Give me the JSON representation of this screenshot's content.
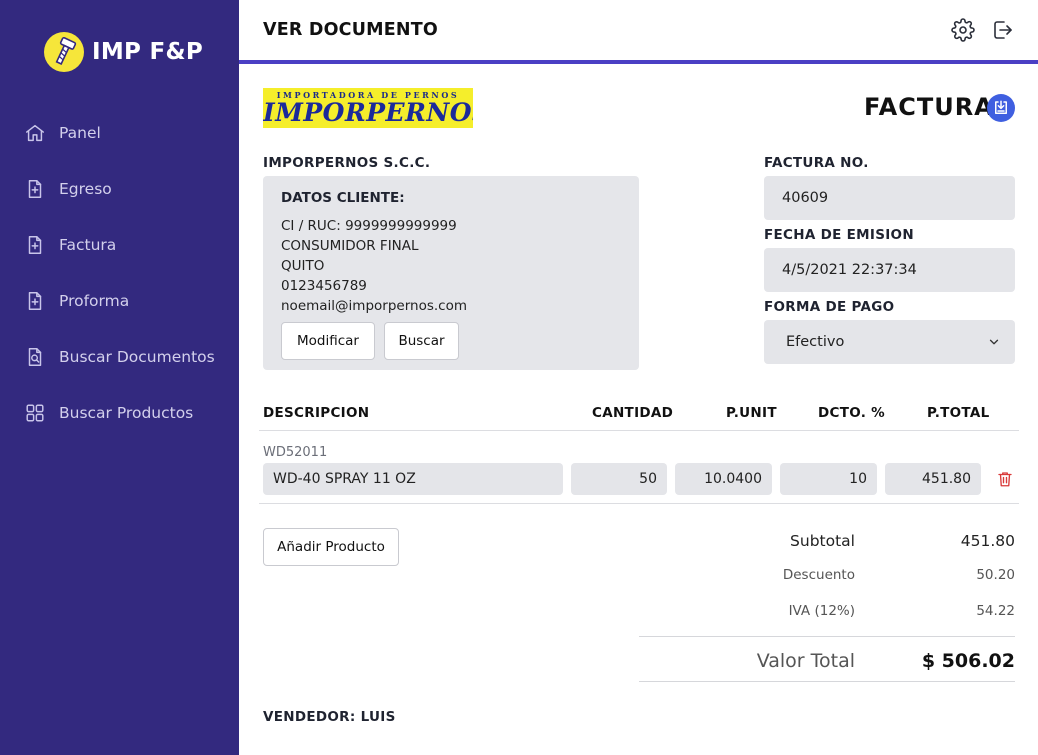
{
  "brand": {
    "name": "IMP F&P",
    "logo_icon": "bolt-icon",
    "logo_color": "#f6e63a"
  },
  "sidebar": {
    "background": "#33297f",
    "items": [
      {
        "label": "Panel",
        "icon": "home-icon"
      },
      {
        "label": "Egreso",
        "icon": "document-plus-icon"
      },
      {
        "label": "Factura",
        "icon": "document-plus-icon"
      },
      {
        "label": "Proforma",
        "icon": "document-plus-icon"
      },
      {
        "label": "Buscar Documentos",
        "icon": "document-search-icon"
      },
      {
        "label": "Buscar Productos",
        "icon": "grid-icon"
      }
    ]
  },
  "header": {
    "title": "VER DOCUMENTO",
    "accent": "#4b3fc4",
    "icons": [
      "gear-icon",
      "logout-icon"
    ]
  },
  "document": {
    "logo_small": "IMPORTADORA DE PERNOS",
    "logo_big": "IMPORPERNOS",
    "title": "FACTURA",
    "company": "IMPORPERNOS S.C.C."
  },
  "client": {
    "title": "DATOS CLIENTE:",
    "ci_ruc": "CI / RUC: 9999999999999",
    "name": "CONSUMIDOR FINAL",
    "city": "QUITO",
    "phone": "0123456789",
    "email": "noemail@imporpernos.com",
    "modify_label": "Modificar",
    "search_label": "Buscar"
  },
  "invoice": {
    "number_label": "FACTURA NO.",
    "number": "40609",
    "date_label": "FECHA DE EMISION",
    "date": "4/5/2021 22:37:34",
    "payment_label": "FORMA DE PAGO",
    "payment": "Efectivo"
  },
  "table": {
    "headers": {
      "description": "DESCRIPCION",
      "quantity": "CANTIDAD",
      "unit_price": "P.UNIT",
      "discount": "DCTO. %",
      "total": "P.TOTAL"
    },
    "rows": [
      {
        "code": "WD52011",
        "description": "WD-40 SPRAY 11 OZ",
        "quantity": "50",
        "unit_price": "10.0400",
        "discount": "10",
        "total": "451.80"
      }
    ],
    "add_label": "Añadir Producto",
    "delete_icon_color": "#d93a3a"
  },
  "totals": {
    "subtotal_label": "Subtotal",
    "subtotal": "451.80",
    "discount_label": "Descuento",
    "discount": "50.20",
    "iva_label": "IVA (12%)",
    "iva": "54.22",
    "total_label": "Valor Total",
    "total": "$ 506.02"
  },
  "vendor": {
    "label": "VENDEDOR:",
    "name": "LUIS"
  }
}
